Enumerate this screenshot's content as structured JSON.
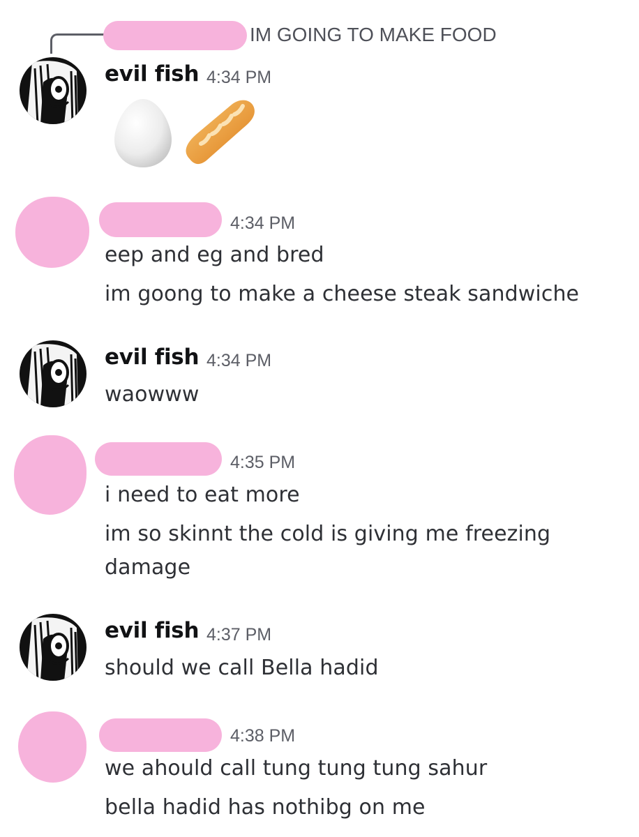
{
  "reply": {
    "text": "IM GOING TO MAKE FOOD"
  },
  "messages": [
    {
      "author": "evil fish",
      "time": "4:34 PM",
      "emojis": [
        "egg-emoji",
        "baguette-emoji"
      ]
    },
    {
      "author": "",
      "time": "4:34 PM",
      "lines": [
        "eep and eg and bred",
        "im goong to make a cheese steak sandwiche"
      ]
    },
    {
      "author": "evil fish",
      "time": "4:34 PM",
      "lines": [
        "waowww"
      ]
    },
    {
      "author": "",
      "time": "4:35 PM",
      "lines": [
        "i need to eat more",
        "im so skinnt the cold is giving me freezing",
        "damage"
      ]
    },
    {
      "author": "evil fish",
      "time": "4:37 PM",
      "lines": [
        "should we call Bella hadid"
      ]
    },
    {
      "author": "",
      "time": "4:38 PM",
      "lines": [
        "we ahould call tung tung tung sahur",
        "bella hadid has nothibg on me"
      ]
    }
  ],
  "colors": {
    "redaction_pink": "#f7b3dc",
    "timestamp_gray": "#5c5e66",
    "username_black": "#111214",
    "text": "#2e3035"
  }
}
